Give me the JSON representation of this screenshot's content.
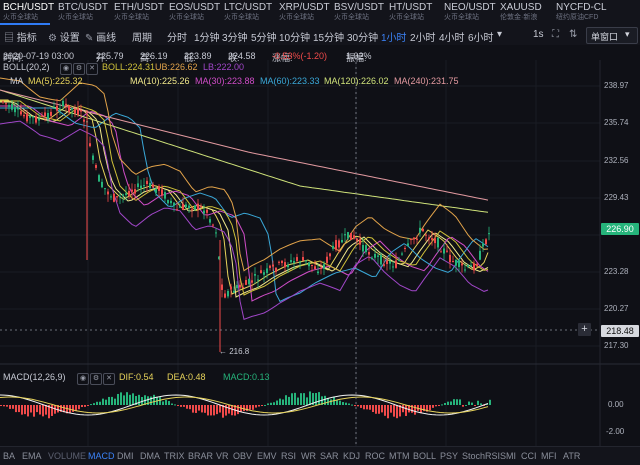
{
  "tabs": [
    {
      "name": "BCH/USDT",
      "sub": "火币全球站"
    },
    {
      "name": "BTC/USDT",
      "sub": "火币全球站"
    },
    {
      "name": "ETH/USDT",
      "sub": "火币全球站"
    },
    {
      "name": "EOS/USDT",
      "sub": "火币全球站"
    },
    {
      "name": "LTC/USDT",
      "sub": "火币全球站"
    },
    {
      "name": "XRP/USDT",
      "sub": "火币全球站"
    },
    {
      "name": "BSV/USDT",
      "sub": "火币全球站"
    },
    {
      "name": "HT/USDT",
      "sub": "火币全球站"
    },
    {
      "name": "NEO/USDT",
      "sub": "火币全球站"
    },
    {
      "name": "XAUUSD",
      "sub": "伦敦金·新浪"
    },
    {
      "name": "NYCFD-CL",
      "sub": "纽约原油CFD"
    }
  ],
  "toolbar": {
    "indicator": "指标",
    "settings": "设置",
    "draw": "画线",
    "period_label": "周期",
    "periods": [
      "分时",
      "1分钟",
      "3分钟",
      "5分钟",
      "10分钟",
      "15分钟",
      "30分钟",
      "1小时",
      "2小时",
      "4小时",
      "6小时",
      "1s"
    ],
    "active_period": "1小时",
    "window_mode": "单窗口"
  },
  "info": {
    "time_label": "时间:",
    "time": "2020-07-19 03:00",
    "open_label": "开:",
    "open": "225.79",
    "high_label": "高:",
    "high": "226.19",
    "low_label": "低:",
    "low": "223.89",
    "close_label": "收:",
    "close": "224.58",
    "change_label": "涨幅:",
    "change": "-0.53%(-1.20)",
    "amp_label": "振幅:",
    "amp": "1.02%"
  },
  "boll_legend": {
    "name": "BOLL(20,2)",
    "boll": "BOLL:224.31",
    "ub": "UB:226.62",
    "lb": "LB:222.00"
  },
  "ma_legend": {
    "name": "MA",
    "ma5": "MA(5):225.32",
    "ma10": "MA(10):225.26",
    "ma30": "MA(30):223.88",
    "ma60": "MA(60):223.33",
    "ma120": "MA(120):226.02",
    "ma240": "MA(240):231.75"
  },
  "price_axis": {
    "ticks": [
      "238.97",
      "235.74",
      "232.56",
      "229.43",
      "226.90",
      "223.28",
      "220.27",
      "218.48",
      "217.30"
    ],
    "current": "226.90",
    "crosshair": "218.48"
  },
  "low_annotation": "← 216.8",
  "macd_legend": {
    "name": "MACD(12,26,9)",
    "dif": "DIF:0.54",
    "dea": "DEA:0.48",
    "macd": "MACD:0.13"
  },
  "macd_axis": {
    "ticks": [
      "0.00",
      "-2.00"
    ]
  },
  "indicators": [
    "BA",
    "EMA",
    "VOLUME",
    "MACD",
    "DMI",
    "DMA",
    "TRIX",
    "BRAR",
    "VR",
    "OBV",
    "EMV",
    "RSI",
    "WR",
    "SAR",
    "KDJ",
    "ROC",
    "MTM",
    "BOLL",
    "PSY",
    "StochRSI",
    "SMI",
    "CCI",
    "MFI",
    "ATR"
  ],
  "active_indicator": "MACD",
  "colors": {
    "up": "#26b47b",
    "down": "#f04a4a",
    "accent": "#3b82f6",
    "ma5": "#e7d35b",
    "ma10": "#f1e98c",
    "ma30": "#d04dc8",
    "ma60": "#3aa8d8",
    "ma120": "#cfe27a",
    "ma240": "#e39aa0",
    "boll": "#d0c23a",
    "ub": "#e2a34a",
    "lb": "#a046c8"
  }
}
